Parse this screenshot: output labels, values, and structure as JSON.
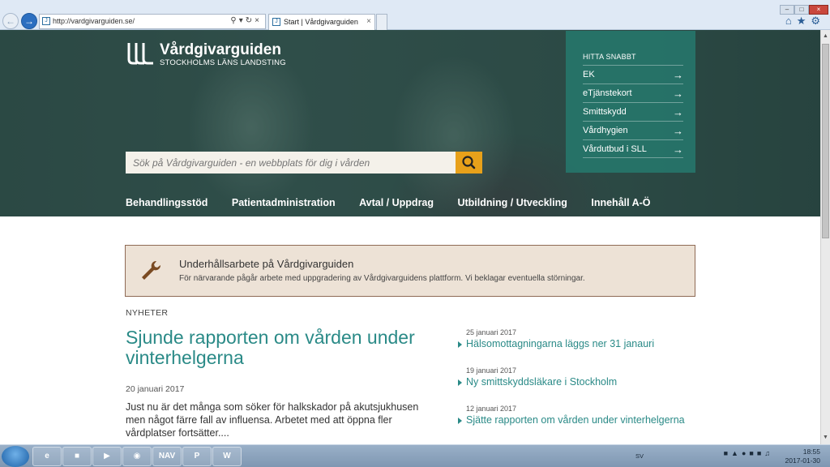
{
  "browser": {
    "url": "http://vardgivarguiden.se/",
    "tab_title": "Start | Vårdgivarguiden",
    "tab_close": "×"
  },
  "site": {
    "logo_name": "Vårdgivarguiden",
    "logo_sub": "STOCKHOLMS LÄNS LANDSTING",
    "search_placeholder": "Sök på Vårdgivarguiden - en webbplats för dig i vården"
  },
  "main_nav": [
    "Behandlingsstöd",
    "Patientadministration",
    "Avtal / Uppdrag",
    "Utbildning / Utveckling",
    "Innehåll A-Ö"
  ],
  "quick_links": {
    "title": "HITTA SNABBT",
    "items": [
      "EK",
      "eTjänstekort",
      "Smittskydd",
      "Vårdhygien",
      "Vårdutbud i SLL"
    ]
  },
  "notice": {
    "title": "Underhållsarbete på Vårdgivarguiden",
    "text": "För närvarande pågår arbete med uppgradering av Vårdgivarguidens plattform. Vi beklagar eventuella störningar."
  },
  "news": {
    "label": "NYHETER",
    "lead": {
      "headline": "Sjunde rapporten om vården under vinterhelgerna",
      "date": "20 januari 2017",
      "text": "Just nu är det många som söker för halkskador på akutsjukhusen men något färre fall av influensa. Arbetet med att öppna fler vårdplatser fortsätter...."
    },
    "items": [
      {
        "date": "25 januari 2017",
        "title": "Hälsomottagningarna läggs ner 31 janauri"
      },
      {
        "date": "19 januari 2017",
        "title": "Ny smittskyddsläkare i Stockholm"
      },
      {
        "date": "12 januari 2017",
        "title": "Sjätte rapporten om vården under vinterhelgerna"
      }
    ]
  },
  "taskbar": {
    "language": "SV",
    "time": "18:55",
    "date": "2017-01-30",
    "app_label_nav": "NAV",
    "app_label_word": "W",
    "app_label_ppt": "P"
  },
  "colors": {
    "accent_teal": "#2a8a87",
    "quick_panel": "#26786c",
    "search_button": "#e8a11a",
    "notice_bg": "#ede2d6"
  },
  "icons": {
    "search": "search-icon",
    "wrench": "wrench-icon",
    "arrow": "arrow-right-icon"
  }
}
